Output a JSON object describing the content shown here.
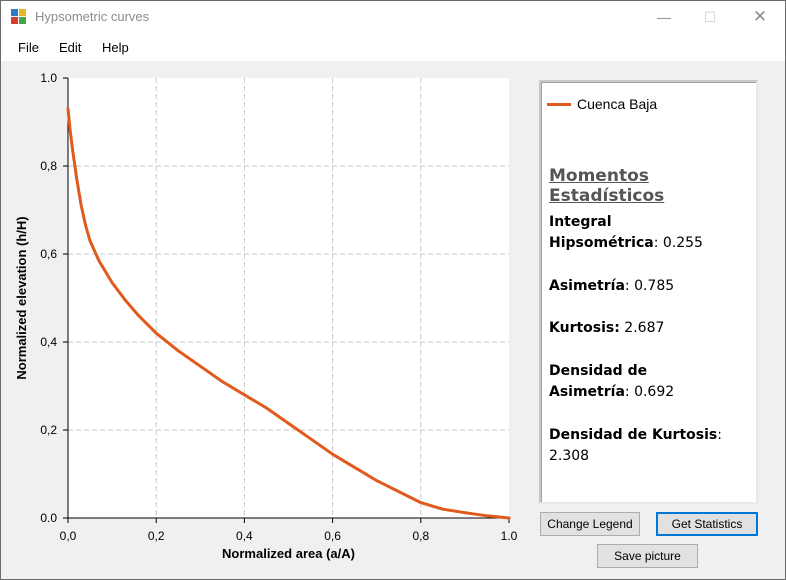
{
  "window": {
    "title": "Hypsometric curves",
    "controls": {
      "minimize": "—",
      "maximize": "☐",
      "close": "✕"
    }
  },
  "menu": [
    "File",
    "Edit",
    "Help"
  ],
  "chart_data": {
    "type": "line",
    "xlabel": "Normalized area (a/A)",
    "ylabel": "Normalized elevation (h/H)",
    "xlim": [
      0,
      1
    ],
    "ylim": [
      0,
      1
    ],
    "xticks": [
      "0,0",
      "0,2",
      "0,4",
      "0,6",
      "0,8",
      "1.0"
    ],
    "yticks": [
      "0.0",
      "0,2",
      "0,4",
      "0,6",
      "0,8",
      "1.0"
    ],
    "grid": true,
    "legend": "right panel",
    "series": [
      {
        "name": "Cuenca Baja",
        "color": "#e05a1c",
        "x": [
          0,
          0.005,
          0.01,
          0.02,
          0.03,
          0.04,
          0.05,
          0.07,
          0.1,
          0.13,
          0.16,
          0.2,
          0.25,
          0.3,
          0.35,
          0.4,
          0.45,
          0.5,
          0.55,
          0.6,
          0.65,
          0.7,
          0.75,
          0.8,
          0.85,
          0.9,
          0.95,
          1.0
        ],
        "y": [
          0.93,
          0.88,
          0.84,
          0.77,
          0.71,
          0.665,
          0.63,
          0.585,
          0.535,
          0.495,
          0.46,
          0.42,
          0.38,
          0.345,
          0.31,
          0.28,
          0.25,
          0.215,
          0.18,
          0.145,
          0.115,
          0.085,
          0.06,
          0.035,
          0.02,
          0.012,
          0.005,
          0.0
        ]
      }
    ]
  },
  "legend": {
    "label": "Cuenca Baja",
    "color": "#e05a1c"
  },
  "stats": {
    "title": "Momentos Estadísticos",
    "integral_label_1": "Integral",
    "integral_label_2": "Hipsométrica",
    "integral_value": ": 0.255",
    "asimetria_label": "Asimetría",
    "asimetria_value": ": 0.785",
    "kurtosis_label": "Kurtosis:",
    "kurtosis_value": " 2.687",
    "densidad_asim_label_1": "Densidad de",
    "densidad_asim_label_2": "Asimetría",
    "densidad_asim_value": ": 0.692",
    "densidad_kurt_label": "Densidad de Kurtosis",
    "densidad_kurt_value": ": 2.308"
  },
  "buttons": {
    "change_legend": "Change Legend",
    "get_statistics": "Get Statistics",
    "save_picture": "Save picture"
  }
}
